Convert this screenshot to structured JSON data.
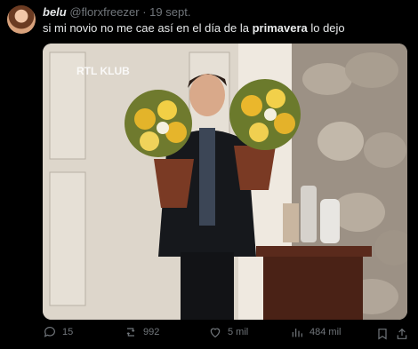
{
  "post": {
    "author_name": "belu",
    "handle": "@florxfreezer",
    "separator": "·",
    "date": "19 sept.",
    "text_before": "si mi novio no me cae así en el día de la ",
    "text_bold": "primavera",
    "text_after": " lo dejo",
    "media_watermark": "RTL KLUB"
  },
  "actions": {
    "replies": "15",
    "reposts": "992",
    "likes": "5 mil",
    "views": "484 mil"
  },
  "icons": [
    "reply-icon",
    "repost-icon",
    "like-icon",
    "views-icon",
    "bookmark-icon",
    "share-icon"
  ]
}
